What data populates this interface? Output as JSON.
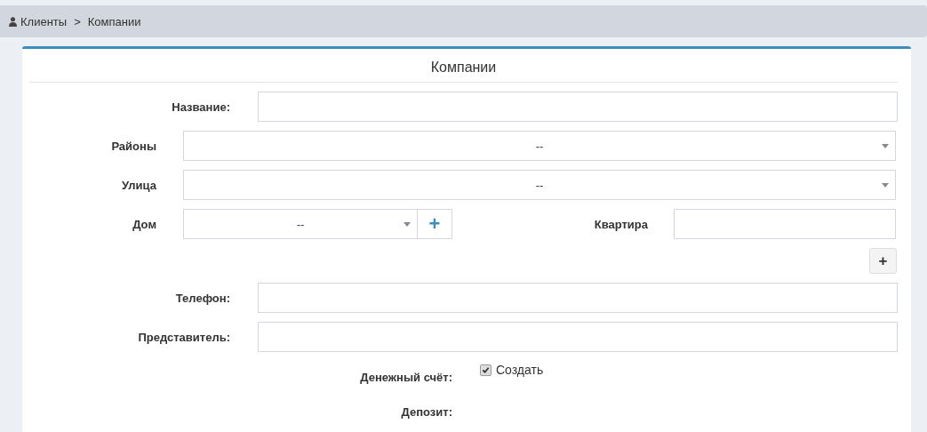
{
  "breadcrumb": {
    "items": [
      "Клиенты",
      "Компании"
    ],
    "separator": ">"
  },
  "card": {
    "title": "Компании"
  },
  "name_field": {
    "label": "Название:"
  },
  "district": {
    "label": "Районы",
    "value": "--"
  },
  "street": {
    "label": "Улица",
    "value": "--"
  },
  "house": {
    "label": "Дом",
    "value": "--",
    "add_button": "+"
  },
  "apartment": {
    "label": "Квартира"
  },
  "add_button": "+",
  "phone": {
    "label": "Телефон:"
  },
  "representative": {
    "label": "Представитель:"
  },
  "account": {
    "label": "Денежный счёт:",
    "checkbox_label": "Создать",
    "checked": true
  },
  "deposit": {
    "label": "Депозит:"
  }
}
